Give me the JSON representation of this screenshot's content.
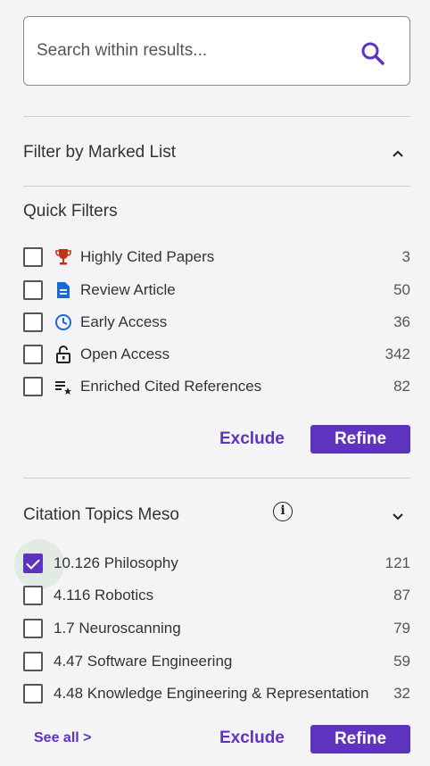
{
  "search": {
    "placeholder": "Search within results..."
  },
  "marked_list": {
    "title": "Filter by Marked List"
  },
  "quick_filters": {
    "title": "Quick Filters",
    "items": [
      {
        "label": "Highly Cited Papers",
        "count": "3",
        "icon": "trophy-icon",
        "checked": false
      },
      {
        "label": "Review Article",
        "count": "50",
        "icon": "document-icon",
        "checked": false
      },
      {
        "label": "Early Access",
        "count": "36",
        "icon": "clock-icon",
        "checked": false
      },
      {
        "label": "Open Access",
        "count": "342",
        "icon": "unlock-icon",
        "checked": false
      },
      {
        "label": "Enriched Cited References",
        "count": "82",
        "icon": "enriched-list-icon",
        "checked": false
      }
    ],
    "exclude_label": "Exclude",
    "refine_label": "Refine"
  },
  "citation_topics": {
    "title": "Citation Topics Meso",
    "items": [
      {
        "label": "10.126 Philosophy",
        "count": "121",
        "checked": true
      },
      {
        "label": "4.116 Robotics",
        "count": "87",
        "checked": false
      },
      {
        "label": "1.7 Neuroscanning",
        "count": "79",
        "checked": false
      },
      {
        "label": "4.47 Software Engineering",
        "count": "59",
        "checked": false
      },
      {
        "label": "4.48 Knowledge Engineering & Representation",
        "count": "32",
        "checked": false
      }
    ],
    "see_all_label": "See all >",
    "exclude_label": "Exclude",
    "refine_label": "Refine"
  },
  "colors": {
    "accent": "#5e33bf",
    "trophy": "#c0321a",
    "document": "#1a6ad6",
    "clock": "#1a6ad6",
    "background": "#f4f4f6"
  }
}
